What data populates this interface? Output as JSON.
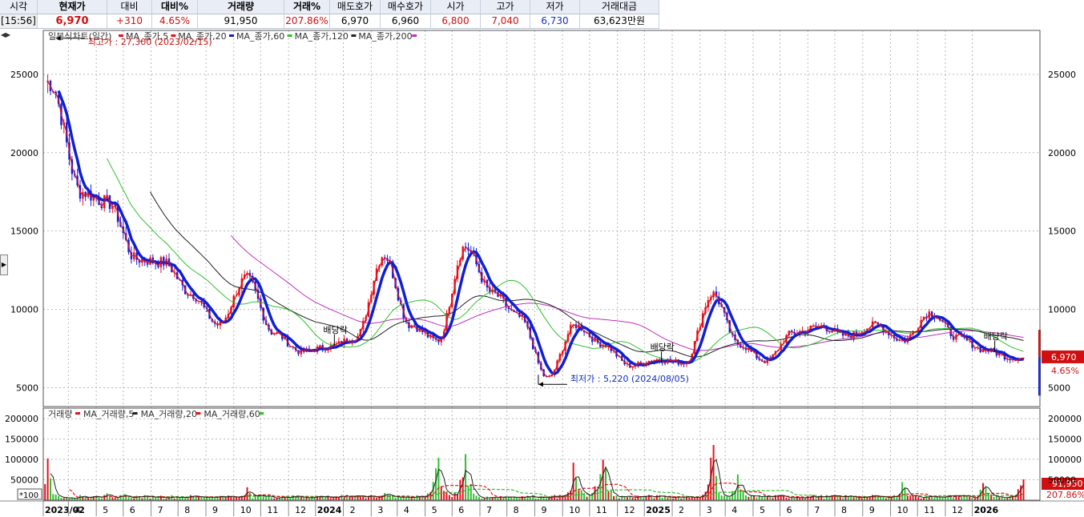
{
  "quote": {
    "headers": [
      "시각",
      "현재가",
      "대비",
      "대비%",
      "거래량",
      "거래%",
      "매도호가",
      "매수호가",
      "시가",
      "고가",
      "저가",
      "거래대금"
    ],
    "values": [
      "[15:56]",
      "6,970",
      "+310",
      "4.65%",
      "91,950",
      "207.86%",
      "6,970",
      "6,960",
      "6,800",
      "7,040",
      "6,730",
      "63,623만원"
    ]
  },
  "nav_icon": "scroll-arrows-icon",
  "side_icon": "expand-arrow-icon",
  "colors": {
    "up": "#e8101a",
    "down": "#1020e0",
    "ma5": "#e8101a",
    "ma20": "#e8101a",
    "ma60": "#1020d0",
    "ma120": "#30c030",
    "ma200": "#202020",
    "ma_long": "#c030c0",
    "grid": "#b8b8b8"
  },
  "chart_data": [
    {
      "type": "line",
      "title": "일본식차트(일간)",
      "legend": [
        "MA_종가,5",
        "MA_종가,20",
        "MA_종가,60",
        "MA_종가,120",
        "MA_종가,200"
      ],
      "x_ticks": [
        "2023/02",
        "4",
        "5",
        "6",
        "7",
        "8",
        "9",
        "10",
        "11",
        "12",
        "2024",
        "2",
        "3",
        "4",
        "5",
        "6",
        "7",
        "8",
        "9",
        "10",
        "11",
        "12",
        "2025",
        "2",
        "3",
        "4",
        "5",
        "6",
        "7",
        "8",
        "9",
        "10",
        "11",
        "12",
        "2026"
      ],
      "yticks": [
        5000,
        10000,
        15000,
        20000,
        25000
      ],
      "ylim": [
        3800,
        27800
      ],
      "grid": true,
      "series": [
        {
          "name": "종가",
          "x": [
            "2023/02",
            "2023/03",
            "2023/04",
            "2023/05",
            "2023/06",
            "2023/07",
            "2023/08",
            "2023/09",
            "2023/10",
            "2023/11",
            "2023/12",
            "2024/01",
            "2024/02",
            "2024/03",
            "2024/04",
            "2024/05",
            "2024/06",
            "2024/07",
            "2024/08",
            "2024/09",
            "2024/10",
            "2024/11",
            "2024/12",
            "2025/01",
            "2025/02",
            "2025/03",
            "2025/04",
            "2025/05",
            "2025/06",
            "2025/07",
            "2025/08",
            "2025/09",
            "2025/10",
            "2025/11",
            "2025/12",
            "2026/01"
          ],
          "values": [
            24500,
            17500,
            16800,
            13200,
            13000,
            11000,
            9000,
            12000,
            8500,
            7300,
            7600,
            8200,
            13500,
            9000,
            8000,
            14000,
            11000,
            9500,
            5600,
            9000,
            7800,
            6400,
            6800,
            6600,
            11000,
            7800,
            6700,
            8500,
            8900,
            8300,
            9000,
            8000,
            9800,
            8200,
            7400,
            6900
          ]
        }
      ],
      "annotations": [
        {
          "text": "최고가 : 27,300 (2023/02/15)"
        },
        {
          "text": "최저가 : 5,220 (2024/08/05)"
        },
        {
          "text": "배당락"
        },
        {
          "text": "배당락"
        },
        {
          "text": "배당락"
        }
      ],
      "current_price": {
        "value": "6,970",
        "change": "4.65%"
      }
    },
    {
      "type": "bar",
      "title": "거래량",
      "legend": [
        "MA_거래량,5",
        "MA_거래량,20",
        "MA_거래량,60"
      ],
      "yticks": [
        50000,
        100000,
        150000,
        200000
      ],
      "ylim": [
        0,
        210000
      ],
      "unit_label": "*100",
      "series": [
        {
          "name": "거래량",
          "x": [
            "2023/02",
            "2023/04",
            "2023/09",
            "2024/01",
            "2024/02",
            "2024/04",
            "2024/05",
            "2024/09",
            "2024/10",
            "2025/02",
            "2025/03",
            "2025/09",
            "2025/12",
            "2026/01"
          ],
          "values": [
            115000,
            35000,
            45000,
            30000,
            30000,
            165000,
            180000,
            140000,
            205000,
            180000,
            80000,
            70000,
            80000,
            91950
          ]
        }
      ],
      "current_volume": {
        "value": "91,950",
        "ratio": "207.86%"
      }
    }
  ]
}
